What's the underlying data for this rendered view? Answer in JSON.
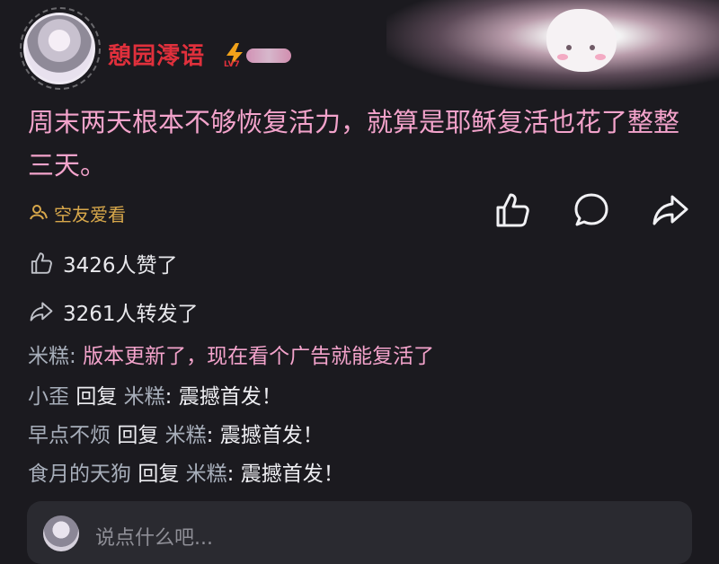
{
  "user": {
    "name": "憩园澪语",
    "level": "LV7"
  },
  "post": {
    "text": "周末两天根本不够恢复活力，就算是耶稣复活也花了整整三天。",
    "view_label": "空友爱看"
  },
  "stats": {
    "likes": "3426人赞了",
    "shares": "3261人转发了"
  },
  "comments": [
    {
      "name": "米糕",
      "sep": ": ",
      "text": "版本更新了，现在看个广告就能复活了"
    },
    {
      "name": "小歪",
      "reply": "回复",
      "target": "米糕",
      "sep": ": ",
      "text": "震撼首发！"
    },
    {
      "name": "早点不烦",
      "reply": "回复",
      "target": "米糕",
      "sep": ": ",
      "text": "震撼首发！"
    },
    {
      "name": "食月的天狗",
      "reply": "回复",
      "target": "米糕",
      "sep": ": ",
      "text": "震撼首发！"
    }
  ],
  "input": {
    "placeholder": "说点什么吧..."
  },
  "icons": {
    "like": "thumbs-up-icon",
    "comment": "comment-bubble-icon",
    "share": "share-arrow-icon"
  },
  "colors": {
    "username": "#e0303c",
    "post_text": "#f3a3cb",
    "view_label": "#d8a84b",
    "background": "#1b1a1f"
  }
}
